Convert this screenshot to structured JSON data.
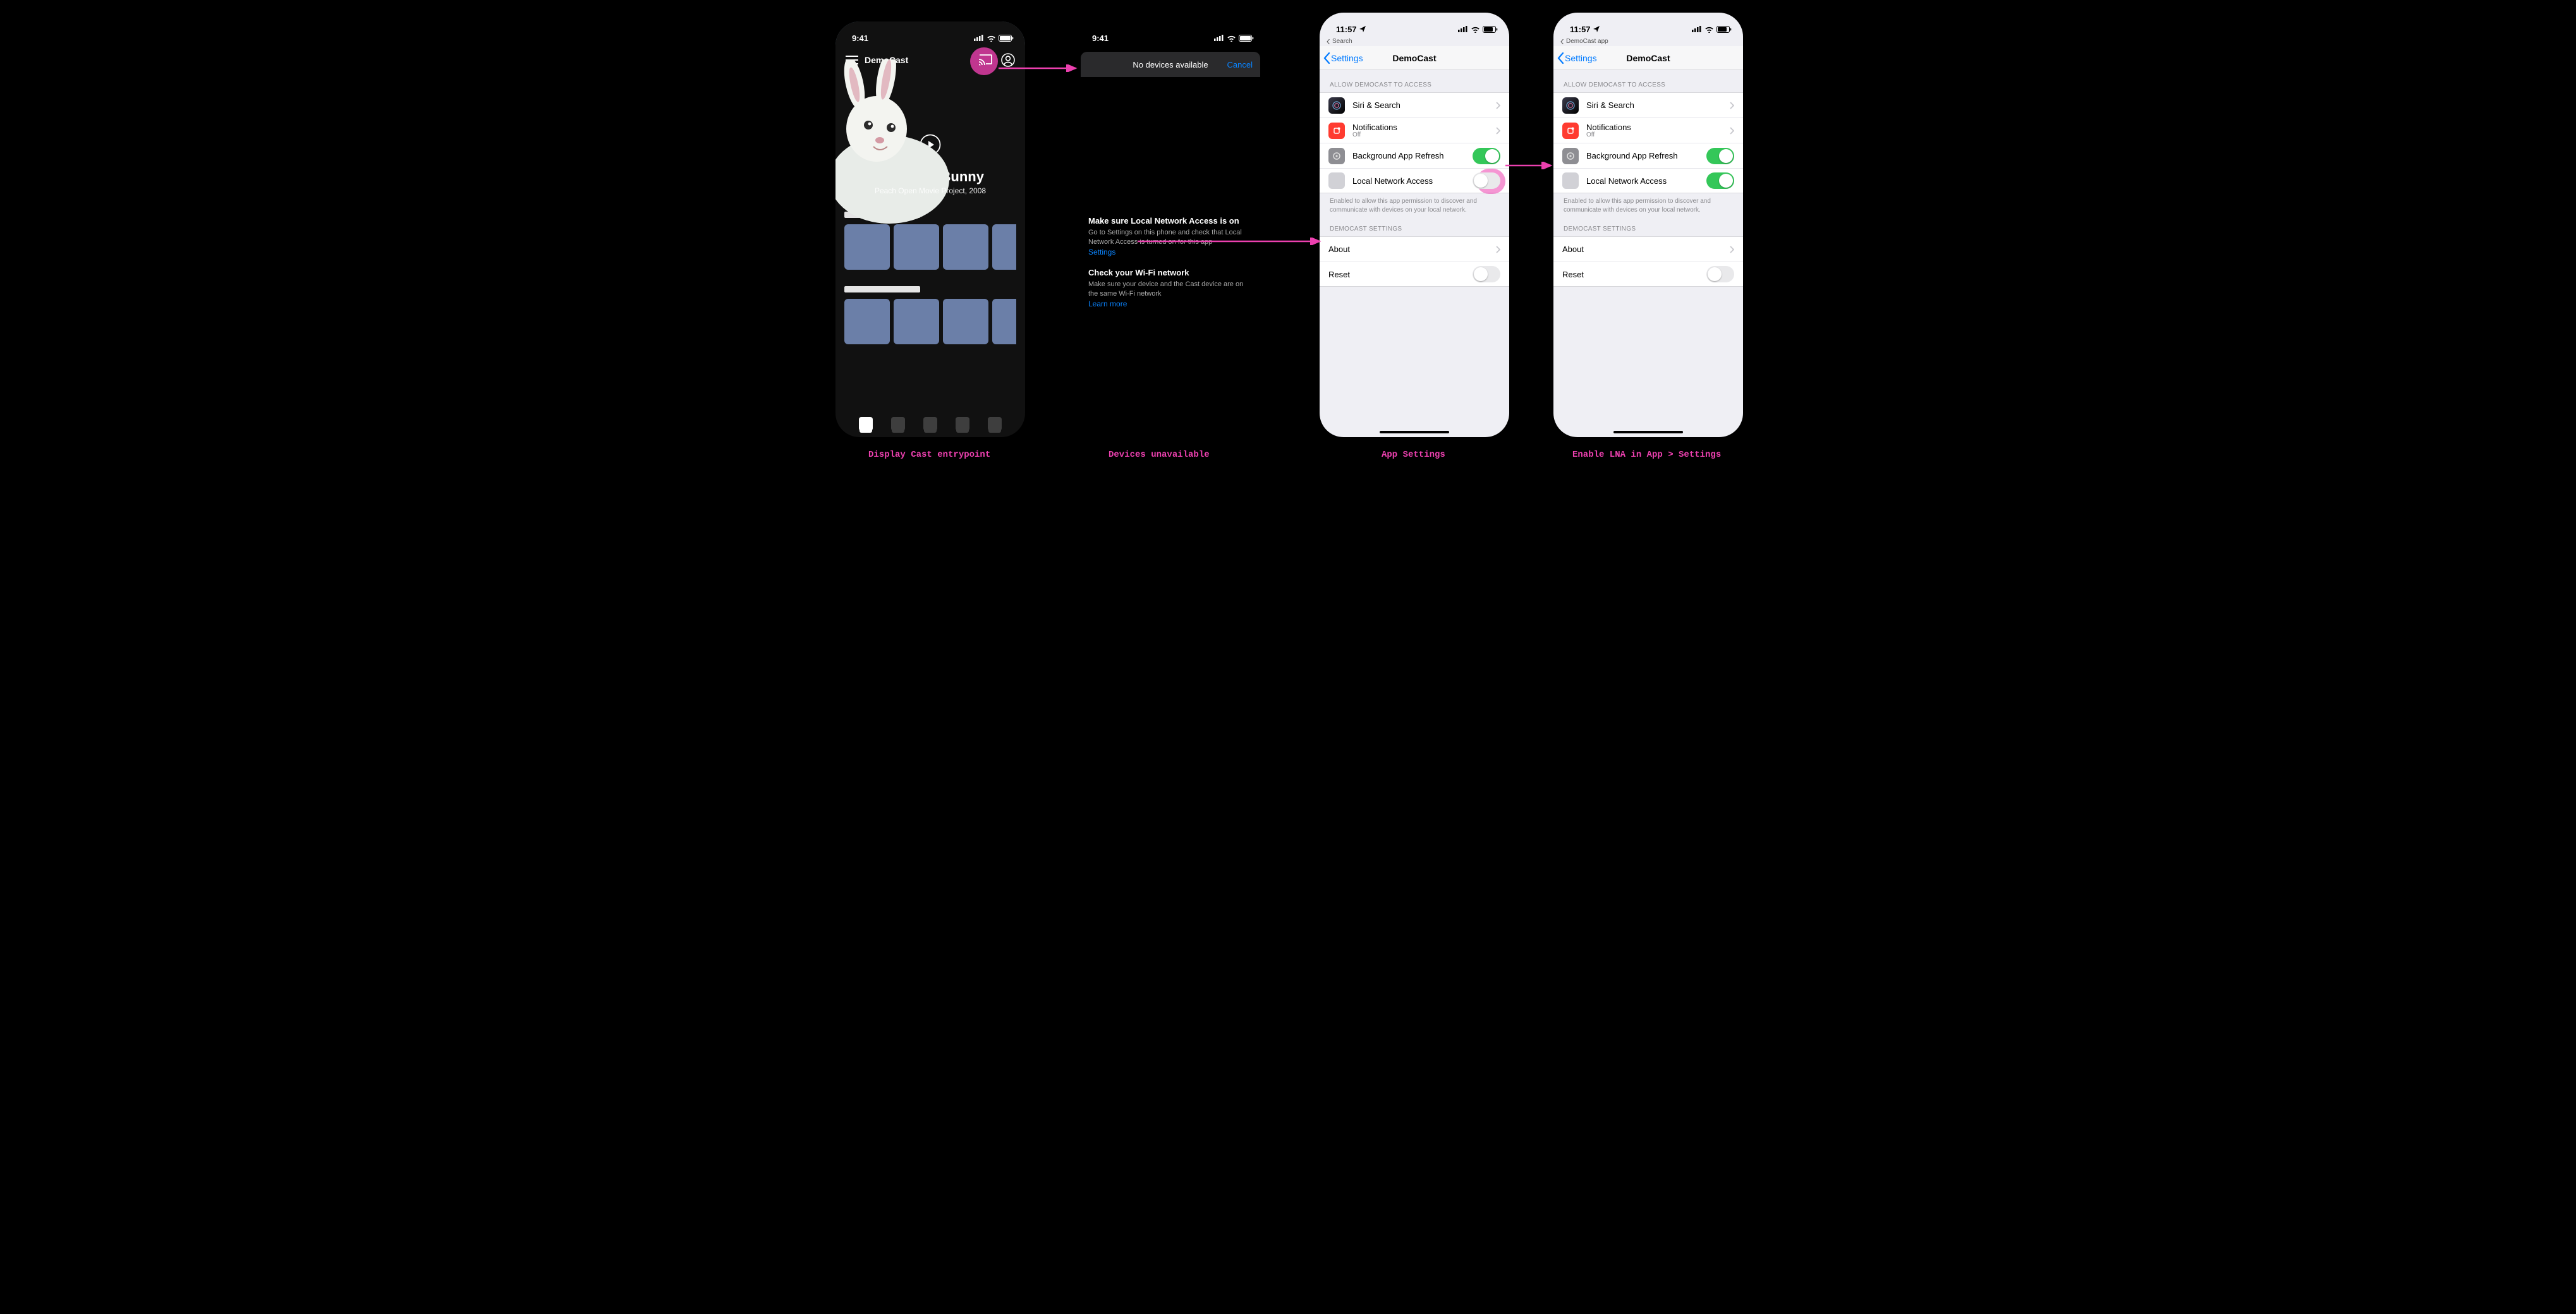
{
  "captions": {
    "c1": "Display Cast entrypoint",
    "c2": "Devices unavailable",
    "c3": "App Settings",
    "c4": "Enable LNA in App > Settings"
  },
  "colors": {
    "accent": "#ec40af",
    "ios_blue": "#007aff",
    "ios_green": "#34c759"
  },
  "screen1": {
    "status_time": "9:41",
    "app_name": "DemoCast",
    "hero": {
      "title": "Big Buck Bunny",
      "subtitle": "Peach Open Movie Project, 2008"
    }
  },
  "screen2": {
    "status_time": "9:41",
    "sheet": {
      "title": "No devices available",
      "cancel": "Cancel"
    },
    "tip_lna": {
      "title": "Make sure Local Network Access is on",
      "body": "Go to Settings on this phone and check that Local Network Access is turned on for this app",
      "settings_link": "Settings"
    },
    "tip_wifi": {
      "title": "Check your Wi-Fi network",
      "body": "Make sure your device and the Cast device are on the same Wi-Fi network",
      "learn_more": "Learn more"
    }
  },
  "screen3": {
    "status_time": "11:57",
    "breadcrumb_back": "Search",
    "nav_back": "Settings",
    "nav_title": "DemoCast",
    "group_access": "ALLOW DEMOCAST TO ACCESS",
    "rows": {
      "siri": "Siri & Search",
      "notifications": "Notifications",
      "notifications_sub": "Off",
      "bg_refresh": "Background App Refresh",
      "lna": "Local Network Access"
    },
    "lna_note": "Enabled to allow this app permission to discover and communicate with devices on your local network.",
    "group_app": "DEMOCAST SETTINGS",
    "about": "About",
    "reset": "Reset",
    "switches": {
      "bg_refresh": true,
      "lna": false,
      "reset": false
    }
  },
  "screen4": {
    "status_time": "11:57",
    "breadcrumb_back": "DemoCast app",
    "nav_back": "Settings",
    "nav_title": "DemoCast",
    "group_access": "ALLOW DEMOCAST TO ACCESS",
    "rows": {
      "siri": "Siri & Search",
      "notifications": "Notifications",
      "notifications_sub": "Off",
      "bg_refresh": "Background App Refresh",
      "lna": "Local Network Access"
    },
    "lna_note": "Enabled to allow this app permission to discover and communicate with devices on your local network.",
    "group_app": "DEMOCAST SETTINGS",
    "about": "About",
    "reset": "Reset",
    "switches": {
      "bg_refresh": true,
      "lna": true,
      "reset": false
    }
  }
}
